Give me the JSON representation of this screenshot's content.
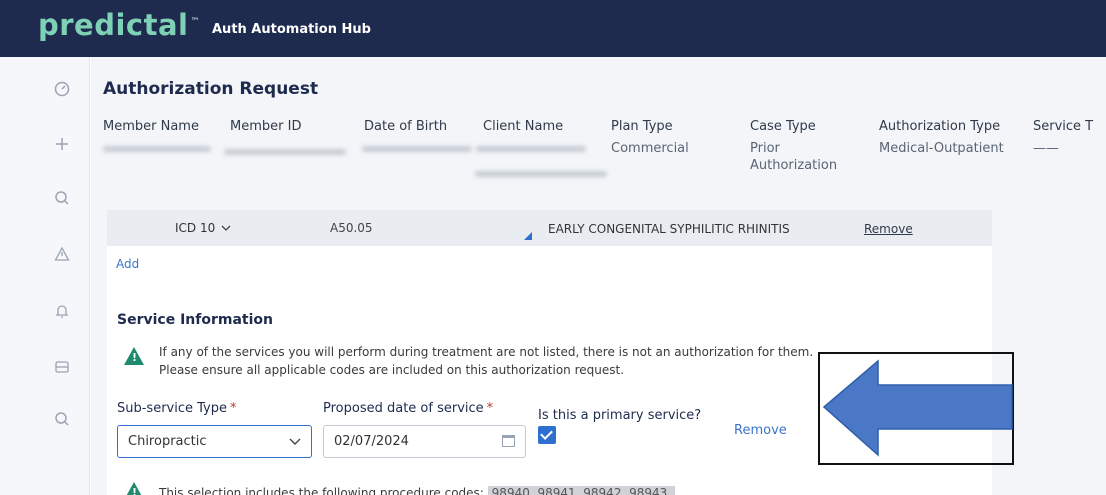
{
  "app": {
    "logo": "predictal",
    "logo_mark": "™",
    "title": "Auth Automation Hub"
  },
  "rail": {
    "icons": [
      "dashboard-icon",
      "plus-icon",
      "search-icon",
      "alert-icon",
      "bell-icon",
      "inbox-icon",
      "search-icon-2"
    ]
  },
  "header": {
    "title": "Authorization Request",
    "columns": [
      {
        "label": "Member Name",
        "value": ""
      },
      {
        "label": "Member ID",
        "value": ""
      },
      {
        "label": "Date of Birth",
        "value": ""
      },
      {
        "label": "Client Name",
        "value": ""
      },
      {
        "label": "Plan Type",
        "value": "Commercial"
      },
      {
        "label": "Case Type",
        "value": "Prior Authorization"
      },
      {
        "label": "Authorization Type",
        "value": "Medical-Outpatient"
      },
      {
        "label": "Service T",
        "value": "——"
      }
    ]
  },
  "diagnosis": {
    "code_type": "ICD 10",
    "code": "A50.05",
    "description": "EARLY CONGENITAL SYPHILITIC RHINITIS",
    "remove_label": "Remove",
    "add_label": "Add"
  },
  "service": {
    "section_title": "Service Information",
    "warning_line1": "If any of the services you will perform during treatment are not listed, there is not an authorization for them.",
    "warning_line2": "Please ensure all applicable codes are included on this authorization request.",
    "subservice_label": "Sub-service Type",
    "subservice_value": "Chiropractic",
    "date_label": "Proposed date of service",
    "date_value": "02/07/2024",
    "primary_label": "Is this a primary service?",
    "primary_checked": true,
    "remove_label": "Remove",
    "required_mark": "*",
    "procedure_text": "This selection includes the following procedure codes:",
    "procedure_codes": "98940, 98941, 98942, 98943,"
  },
  "colors": {
    "topbar": "#1f2b4e",
    "logo": "#7fd1b5",
    "accent": "#2f6fd0",
    "warning": "#1e8a6e",
    "annotation_arrow": "#4a78c6"
  }
}
